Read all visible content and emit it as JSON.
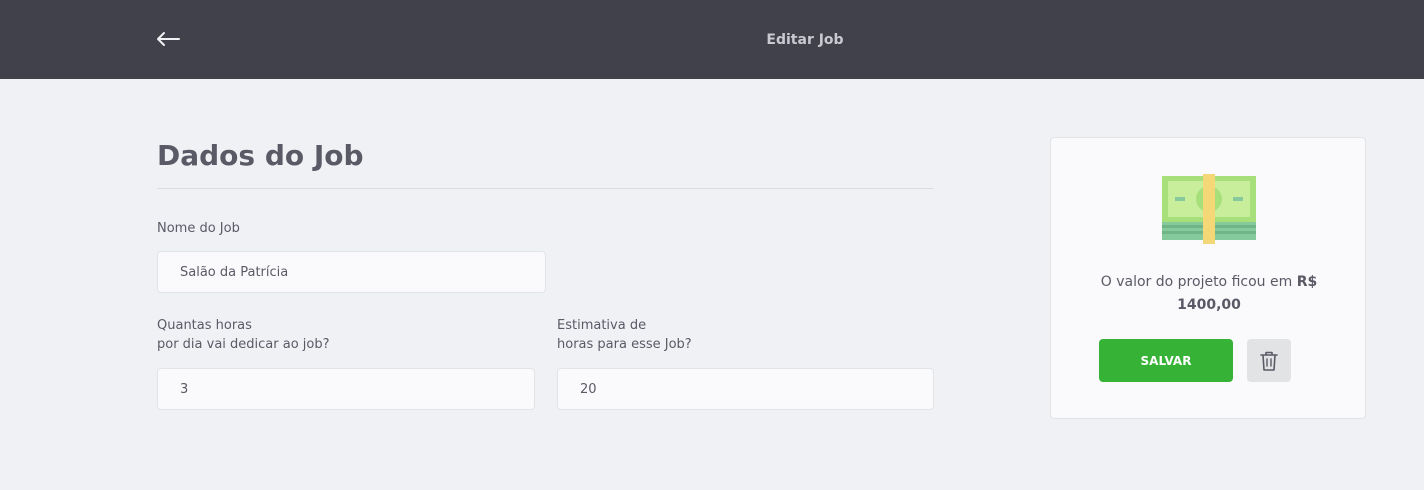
{
  "header": {
    "title": "Editar Job",
    "back_icon": "arrow-left-icon"
  },
  "form": {
    "title": "Dados do Job",
    "job_name": {
      "label": "Nome do Job",
      "value": "Salão da Patrícia"
    },
    "daily_hours": {
      "label_line1": "Quantas horas",
      "label_line2": "por dia vai dedicar ao job?",
      "value": "3"
    },
    "total_hours": {
      "label_line1": "Estimativa de",
      "label_line2": "horas para esse Job?",
      "value": "20"
    }
  },
  "summary": {
    "icon": "money-icon",
    "text_prefix": "O valor do projeto ficou em ",
    "currency": "R$",
    "amount": "1400,00",
    "save_label": "SALVAR",
    "delete_icon": "trash-icon",
    "save_color": "#36b336"
  }
}
